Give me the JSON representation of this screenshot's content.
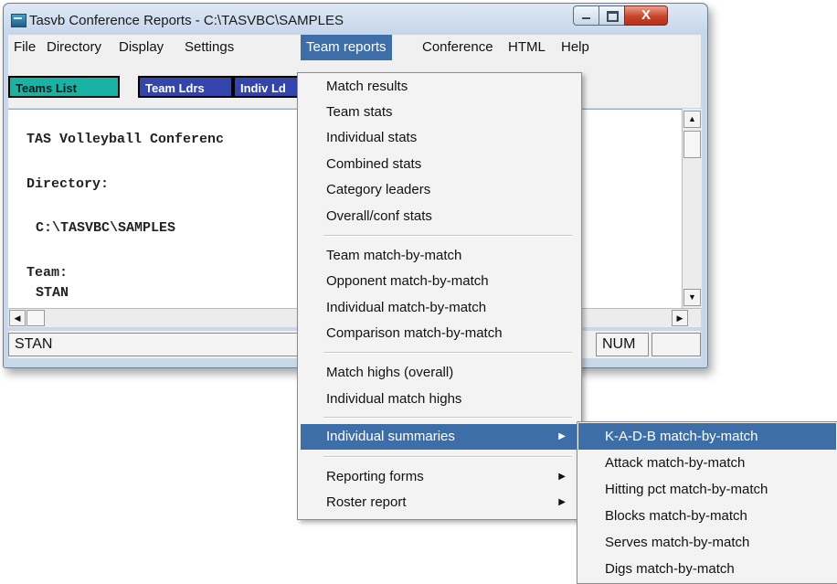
{
  "window": {
    "title": "Tasvb Conference Reports - C:\\TASVBC\\SAMPLES",
    "close_glyph": "X"
  },
  "menubar": {
    "items": [
      "File",
      "Directory",
      "Display",
      "Settings",
      "Team reports",
      "Conference",
      "HTML",
      "Help"
    ],
    "active": "Team reports"
  },
  "toolbar": {
    "teams_list": "Teams List",
    "team_ldrs": "Team Ldrs",
    "indiv_ldrs": "Indiv Ld"
  },
  "content": {
    "lines": [
      "TAS Volleyball Conferenc",
      "Directory:",
      "C:\\TASVBC\\SAMPLES",
      "Team:",
      "STAN"
    ]
  },
  "statusbar": {
    "main": "STAN",
    "num": "NUM",
    "extra": ""
  },
  "team_reports_menu": {
    "items": [
      "Match results",
      "Team stats",
      "Individual stats",
      "Combined stats",
      "Category leaders",
      "Overall/conf stats",
      "Team match-by-match",
      "Opponent match-by-match",
      "Individual match-by-match",
      "Comparison match-by-match",
      "Match highs (overall)",
      "Individual match highs",
      "Individual summaries",
      "Reporting forms",
      "Roster report"
    ],
    "highlighted": "Individual summaries"
  },
  "individual_summaries_submenu": {
    "items": [
      "K-A-D-B match-by-match",
      "Attack match-by-match",
      "Hitting pct match-by-match",
      "Blocks match-by-match",
      "Serves match-by-match",
      "Digs match-by-match"
    ],
    "highlighted": "K-A-D-B match-by-match"
  },
  "colors": {
    "accent": "#3d6ea8",
    "teams_button": "#19b3a6",
    "ldrs_button": "#3344aa",
    "close_button": "#c7452b"
  },
  "icons": {
    "app": "app-icon",
    "minimize": "minimize-icon",
    "maximize": "maximize-icon",
    "close": "close-icon",
    "submenu_arrow": "chevron-right-icon",
    "scroll_up": "arrow-up-icon",
    "scroll_down": "arrow-down-icon",
    "scroll_left": "arrow-left-icon",
    "scroll_right": "arrow-right-icon"
  }
}
